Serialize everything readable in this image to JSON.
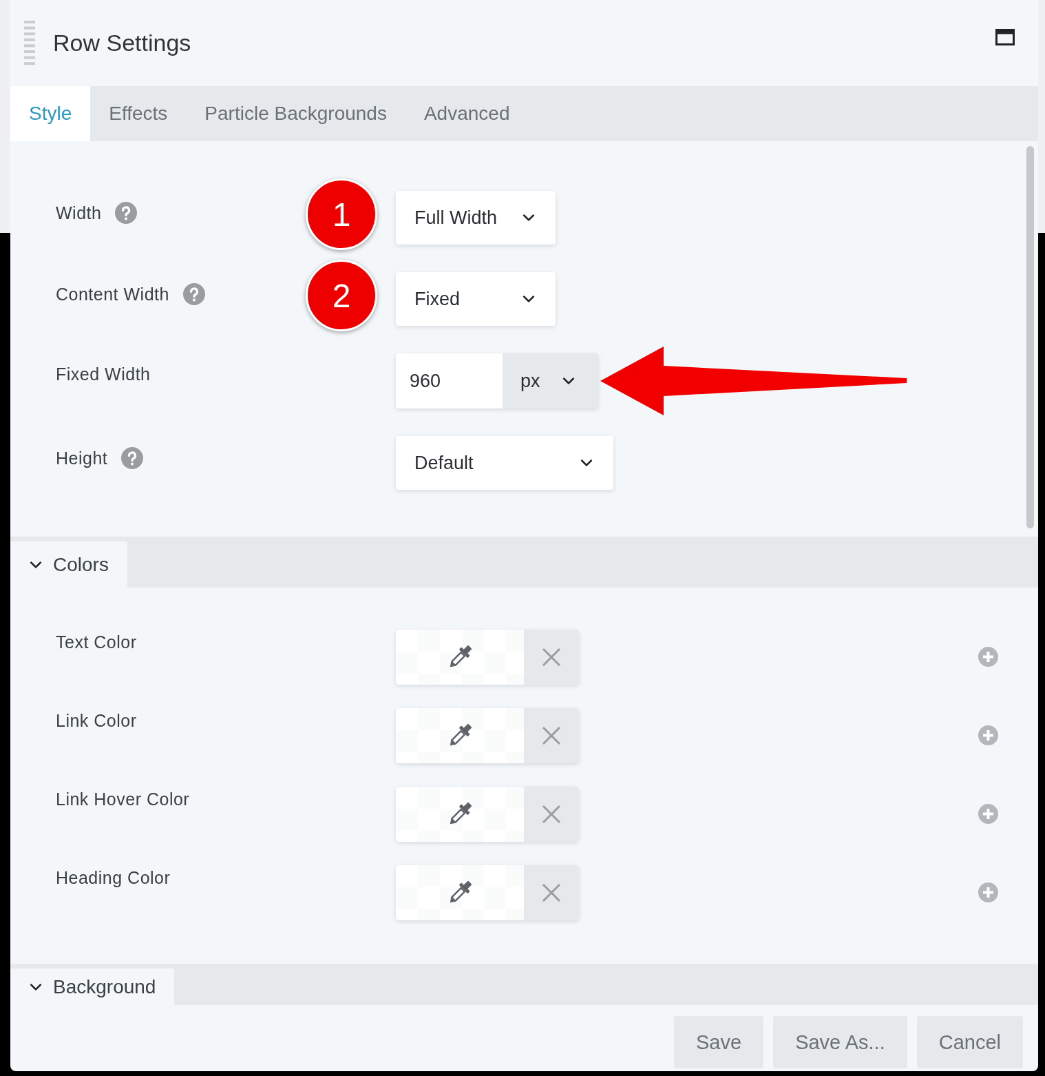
{
  "window": {
    "title": "Row Settings"
  },
  "tabs": [
    {
      "label": "Style",
      "selected": true
    },
    {
      "label": "Effects",
      "selected": false
    },
    {
      "label": "Particle Backgrounds",
      "selected": false
    },
    {
      "label": "Advanced",
      "selected": false
    }
  ],
  "fields": [
    {
      "label": "Width",
      "help": true,
      "kind": "select",
      "value": "Full Width",
      "marker": "1"
    },
    {
      "label": "Content Width",
      "help": true,
      "kind": "select",
      "value": "Fixed",
      "marker": "2"
    },
    {
      "label": "Fixed Width",
      "help": false,
      "kind": "unit",
      "value": "960",
      "unit": "px",
      "arrow": true
    },
    {
      "label": "Height",
      "help": true,
      "kind": "select",
      "value": "Default"
    }
  ],
  "sections": [
    {
      "title": "Colors",
      "expanded": true,
      "items": [
        {
          "label": "Text Color"
        },
        {
          "label": "Link Color"
        },
        {
          "label": "Link Hover Color"
        },
        {
          "label": "Heading Color"
        }
      ]
    },
    {
      "title": "Background",
      "expanded": true
    }
  ],
  "buttons": [
    "Save",
    "Save As...",
    "Cancel"
  ]
}
